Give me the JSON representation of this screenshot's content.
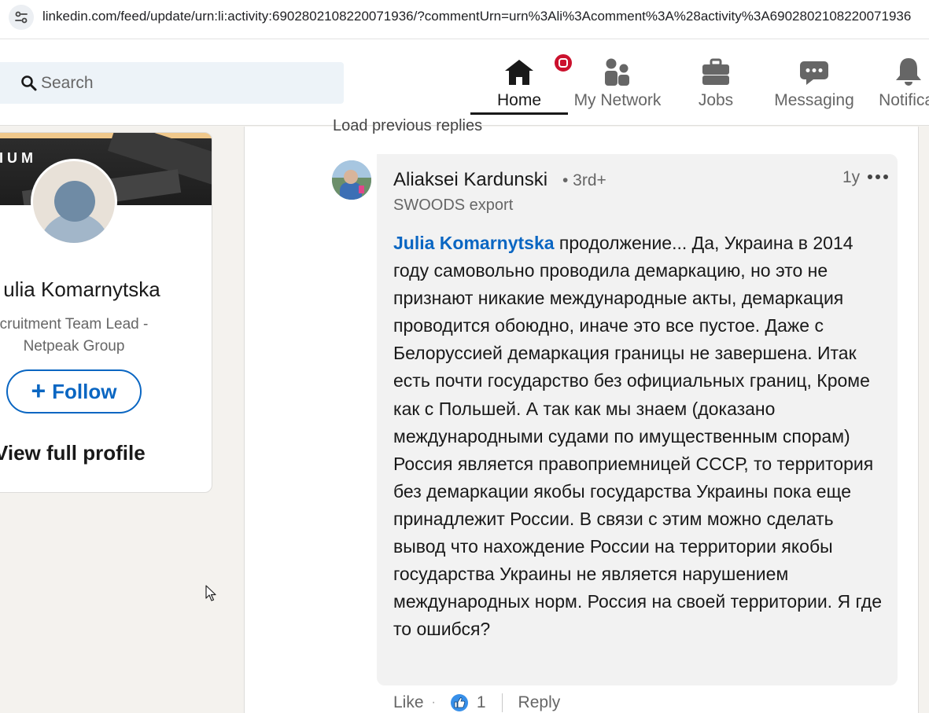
{
  "browser": {
    "url": "linkedin.com/feed/update/urn:li:activity:6902802108220071936/?commentUrn=urn%3Ali%3Acomment%3A%28activity%3A6902802108220071936"
  },
  "header": {
    "search": {
      "placeholder": "Search"
    },
    "nav": [
      {
        "label": "Home",
        "icon": "home-icon",
        "active": true,
        "has_notification": true
      },
      {
        "label": "My Network",
        "icon": "network-icon"
      },
      {
        "label": "Jobs",
        "icon": "briefcase-icon"
      },
      {
        "label": "Messaging",
        "icon": "messaging-icon"
      },
      {
        "label": "Notificat",
        "icon": "bell-icon"
      }
    ]
  },
  "profile_card": {
    "banner_text": "IUM",
    "name": "ulia Komarnytska",
    "headline": "cruitment Team Lead - Netpeak Group",
    "follow_label": "Follow",
    "view_profile_label": "View full profile"
  },
  "feed": {
    "load_previous": "Load previous replies",
    "comment": {
      "author": "Aliaksei Kardunski",
      "degree": "• 3rd+",
      "subtitle": "SWOODS export",
      "time": "1y",
      "mention": "Julia Komarnytska",
      "text": " продолжение... Да, Украина в 2014 году самовольно проводила демаркацию, но это не признают никакие международные акты, демаркация проводится обоюдно, иначе это все пустое. Даже с Белоруссией демаркация границы не завершена. Итак есть почти государство без официальных границ, Кроме как с Польшей. А так как мы знаем (доказано международными судами по имущественным спорам) Россия является правоприемницей СССР, то территория без демаркации якобы государства Украины пока еще принадлежит России. В связи с этим можно сделать вывод что нахождение России на территории якобы государства Украины не является нарушением международных норм. Россия на своей территории. Я где то ошибся?"
    },
    "actions": {
      "like_label": "Like",
      "separator": "·",
      "reaction_count": "1",
      "reply_label": "Reply"
    }
  },
  "colors": {
    "linkedin_blue": "#0a66c2",
    "notification_red": "#cb112d"
  }
}
